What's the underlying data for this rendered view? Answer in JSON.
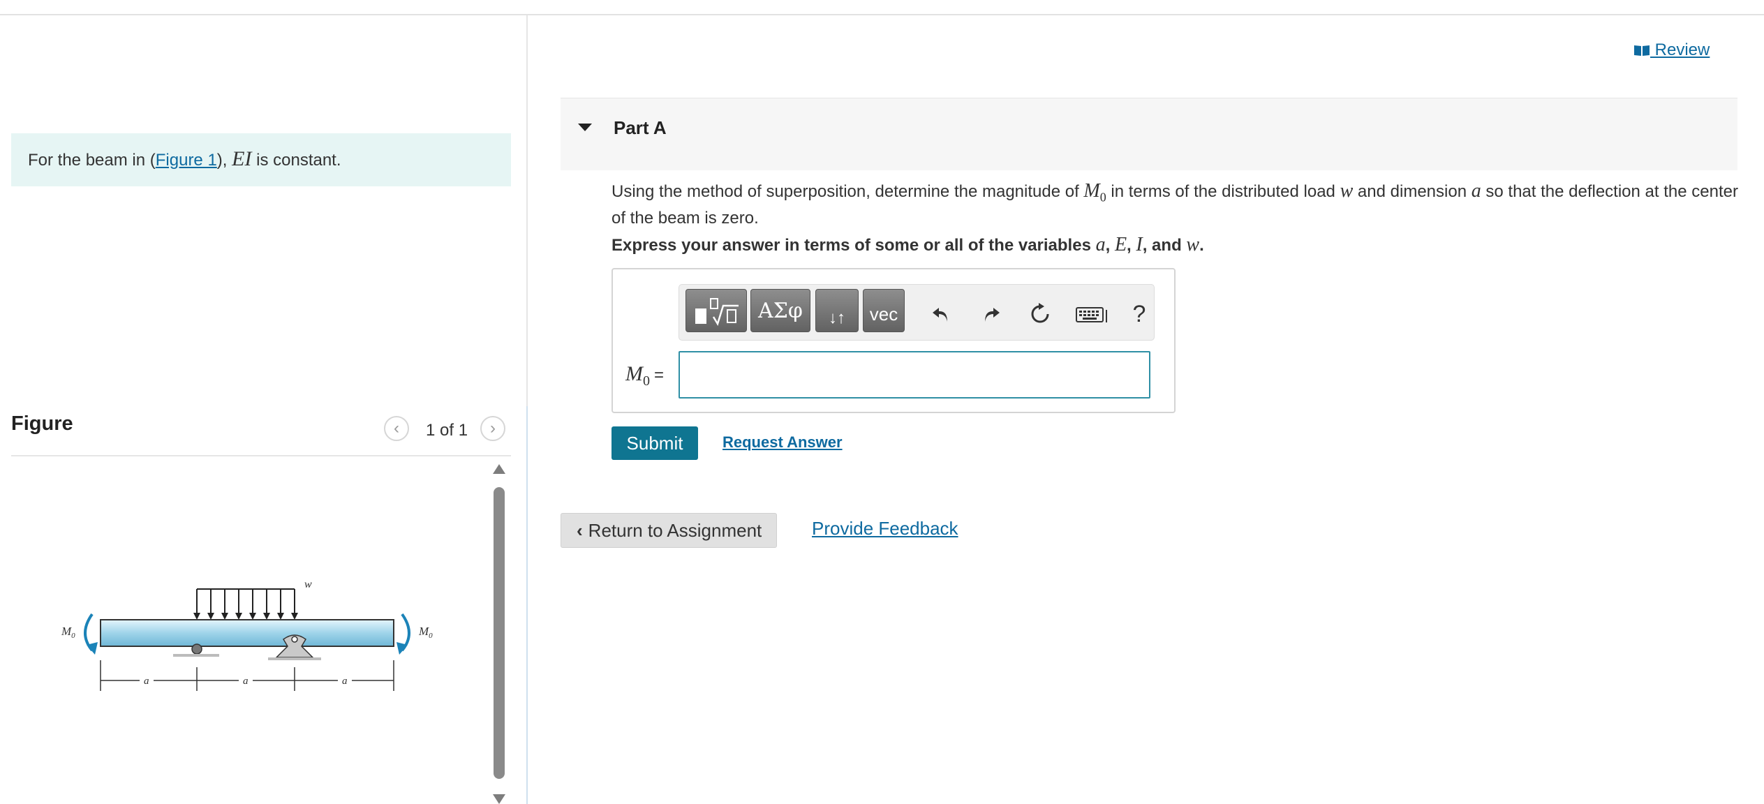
{
  "intro": {
    "prefix": "For the beam in (",
    "figure_link": "Figure 1",
    "suffix_open": "), ",
    "ei": "EI",
    "suffix": " is constant."
  },
  "figure_panel": {
    "title": "Figure",
    "counter": "1 of 1",
    "prev_icon": "chevron-left-icon",
    "next_icon": "chevron-right-icon",
    "labels": {
      "load": "w",
      "moment_left": "M",
      "moment_right": "M",
      "moment_sub": "0",
      "dim_1": "a",
      "dim_2": "a",
      "dim_3": "a"
    }
  },
  "review": {
    "icon": "book-icon",
    "label": " Review"
  },
  "part": {
    "title": "Part A",
    "caret_icon": "caret-down-icon"
  },
  "question": {
    "t1": "Using the method of superposition, determine the magnitude of ",
    "m": "M",
    "m_sub": "0",
    "t2": " in terms of the distributed load ",
    "w": "w",
    "t3": " and dimension ",
    "a": "a",
    "t4": " so that the deflection at the center of the beam is zero."
  },
  "instruction": {
    "t1": "Express your answer in terms of some or all of the variables ",
    "a": "a",
    "sep1": ", ",
    "e": "E",
    "sep2": ", ",
    "i": "I",
    "sep3": ", and ",
    "w": "w",
    "end": "."
  },
  "toolbar": {
    "greek": "ΑΣφ",
    "arrows": "↓↑",
    "vec": "vec",
    "help": "?",
    "icons": [
      "templates-icon",
      "greek-icon",
      "arrows-icon",
      "vec-icon",
      "undo-icon",
      "redo-icon",
      "reset-icon",
      "keyboard-icon",
      "help-icon"
    ]
  },
  "answer": {
    "label_var": "M",
    "label_sub": "0",
    "label_eq": "=",
    "value": ""
  },
  "actions": {
    "submit": "Submit",
    "request_answer": "Request Answer",
    "return": "Return to Assignment",
    "feedback": "Provide Feedback"
  },
  "colors": {
    "accent": "#0f7591",
    "link": "#0e6aa0",
    "intro_bg": "#e6f5f4",
    "beam": "#9fd4ea"
  }
}
